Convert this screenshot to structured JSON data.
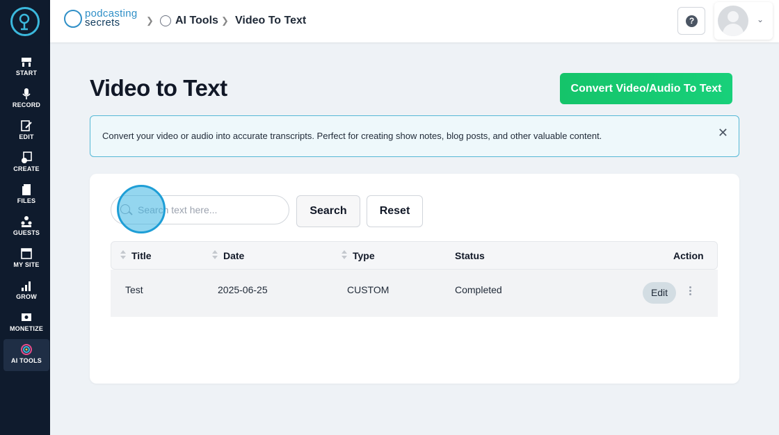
{
  "sidebar": {
    "items": [
      {
        "label": "START",
        "icon": "start-icon"
      },
      {
        "label": "RECORD",
        "icon": "microphone-icon"
      },
      {
        "label": "EDIT",
        "icon": "edit-icon"
      },
      {
        "label": "CREATE",
        "icon": "create-icon"
      },
      {
        "label": "FILES",
        "icon": "files-icon"
      },
      {
        "label": "GUESTS",
        "icon": "guests-icon"
      },
      {
        "label": "MY SITE",
        "icon": "site-icon"
      },
      {
        "label": "GROW",
        "icon": "grow-icon"
      },
      {
        "label": "MONETIZE",
        "icon": "monetize-icon"
      },
      {
        "label": "AI TOOLS",
        "icon": "ai-tools-icon"
      }
    ],
    "active": "AI TOOLS"
  },
  "header": {
    "brand_line1": "podcasting",
    "brand_line2": "secrets",
    "breadcrumb": [
      "AI Tools",
      "Video To Text"
    ]
  },
  "main": {
    "title": "Video to Text",
    "convert_button": "Convert Video/Audio To Text",
    "info_text": "Convert your video or audio into accurate transcripts. Perfect for creating show notes, blog posts, and other valuable content.",
    "info_close": "✕",
    "search_placeholder": "Search text here...",
    "search_button": "Search",
    "reset_button": "Reset",
    "table": {
      "columns": [
        "Title",
        "Date",
        "Type",
        "Status",
        "Action"
      ],
      "rows": [
        {
          "title": "Test",
          "date": "2025-06-25",
          "type": "CUSTOM",
          "status": "Completed",
          "action": "Edit"
        }
      ]
    }
  },
  "colors": {
    "sidebar_bg": "#0f1b2d",
    "accent_green": "#18c96f",
    "info_border": "#55b8d6"
  }
}
